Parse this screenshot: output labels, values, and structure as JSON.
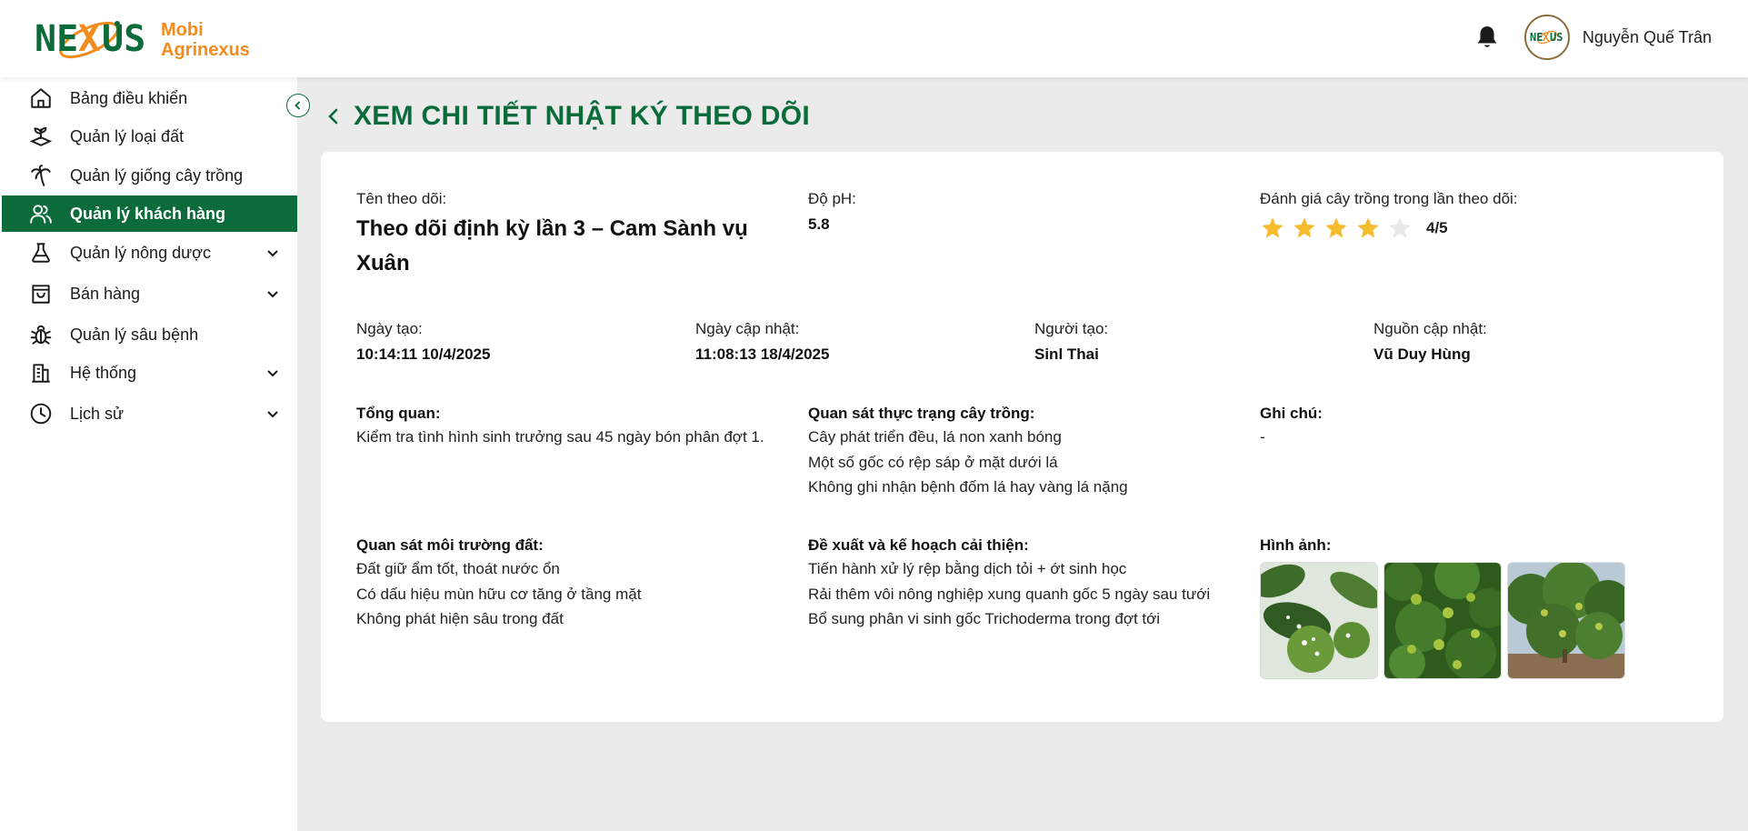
{
  "brand": {
    "logo_word": "NEXUS",
    "name_line1": "Mobi",
    "name_line2": "Agrinexus"
  },
  "header": {
    "user_name": "Nguyễn Quế Trân",
    "avatar_text": "NEXUS"
  },
  "sidebar": {
    "items": [
      {
        "label": "Bảng điều khiển",
        "icon": "home-icon"
      },
      {
        "label": "Quản lý loại đất",
        "icon": "soil-icon"
      },
      {
        "label": "Quản lý giống cây trồng",
        "icon": "palm-tree-icon"
      },
      {
        "label": "Quản lý khách hàng",
        "icon": "users-icon",
        "active": true
      },
      {
        "label": "Quản lý nông dược",
        "icon": "flask-icon",
        "expandable": true
      },
      {
        "label": "Bán hàng",
        "icon": "shopping-bag-icon",
        "expandable": true
      },
      {
        "label": "Quản lý sâu bệnh",
        "icon": "bug-icon"
      },
      {
        "label": "Hệ thống",
        "icon": "building-icon",
        "expandable": true
      },
      {
        "label": "Lịch sử",
        "icon": "clock-icon",
        "expandable": true
      }
    ]
  },
  "page": {
    "title": "XEM CHI TIẾT NHẬT KÝ THEO DÕI"
  },
  "detail": {
    "name_label": "Tên theo dõi:",
    "name_value": "Theo dõi định kỳ lần 3 – Cam Sành vụ Xuân",
    "ph_label": "Độ pH:",
    "ph_value": "5.8",
    "rating_label": "Đánh giá cây trồng trong lần theo dõi:",
    "rating_value": 4,
    "rating_max": 5,
    "rating_text": "4/5",
    "created_label": "Ngày tạo:",
    "created_value": "10:14:11 10/4/2025",
    "updated_label": "Ngày cập nhật:",
    "updated_value": "11:08:13 18/4/2025",
    "creator_label": "Người tạo:",
    "creator_value": "Sinl Thai",
    "updater_label": "Nguồn cập nhật:",
    "updater_value": "Vũ Duy Hùng",
    "overview_title": "Tổng quan:",
    "overview_lines": [
      "Kiểm tra tình hình sinh trưởng sau 45 ngày bón phân đợt  1."
    ],
    "crop_obs_title": "Quan sát thực trạng cây trồng:",
    "crop_obs_lines": [
      "Cây phát triển đều, lá non xanh bóng",
      "Một số gốc có rệp sáp ở mặt dưới lá",
      "Không ghi nhận bệnh đốm lá hay vàng lá nặng"
    ],
    "note_title": "Ghi chú:",
    "note_lines": [
      "-"
    ],
    "soil_obs_title": "Quan sát môi trường đất:",
    "soil_obs_lines": [
      "Đất giữ ẩm tốt, thoát nước ổn",
      "Có dấu hiệu mùn hữu cơ tăng ở tầng mặt",
      "Không phát hiện sâu trong đất"
    ],
    "plan_title": "Đề xuất và kế hoạch cải thiện:",
    "plan_lines": [
      "Tiến hành xử lý rệp bằng dịch tỏi + ớt sinh học",
      "Rải thêm vôi nông nghiệp xung quanh gốc 5 ngày sau tưới",
      "Bổ sung phân vi sinh gốc Trichoderma trong đợt tới"
    ],
    "images_title": "Hình ảnh:"
  },
  "colors": {
    "primary": "#0b6b3a",
    "brand_orange": "#f28c1e",
    "star": "#f5bd2e",
    "star_empty": "#e9e9e9"
  }
}
